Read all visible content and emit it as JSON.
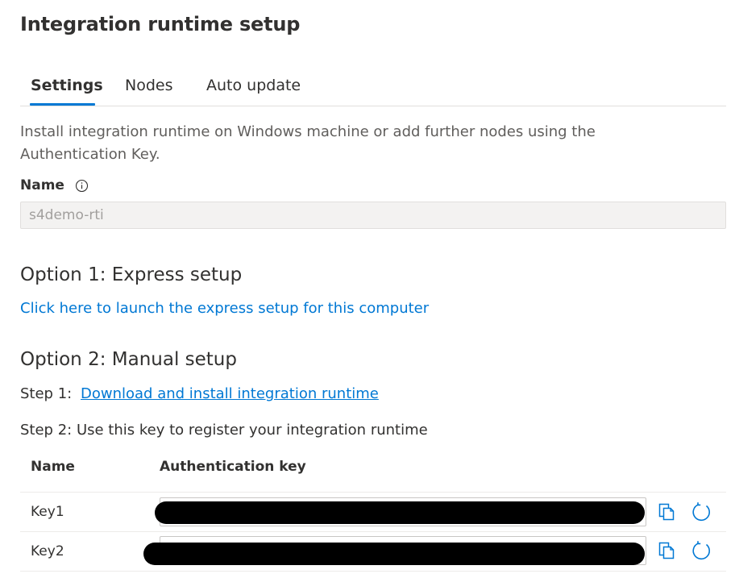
{
  "header": {
    "title": "Integration runtime setup"
  },
  "tabs": [
    {
      "label": "Settings",
      "active": true
    },
    {
      "label": "Nodes",
      "active": false
    },
    {
      "label": "Auto update",
      "active": false
    }
  ],
  "description": "Install integration runtime on Windows machine or add further nodes using the Authentication Key.",
  "name_field": {
    "label": "Name",
    "value": "s4demo-rti",
    "info_icon": "info-icon"
  },
  "option1": {
    "heading": "Option 1: Express setup",
    "link": "Click here to launch the express setup for this computer"
  },
  "option2": {
    "heading": "Option 2: Manual setup",
    "step1_label": "Step 1:",
    "step1_link": "Download and install integration runtime",
    "step2_label": "Step 2: Use this key to register your integration runtime"
  },
  "keys_table": {
    "columns": [
      "Name",
      "Authentication key"
    ],
    "rows": [
      {
        "name": "Key1"
      },
      {
        "name": "Key2"
      }
    ],
    "actions": [
      "copy-icon",
      "refresh-icon"
    ]
  },
  "colors": {
    "accent": "#0078d4",
    "text": "#323130",
    "muted": "#605e5c",
    "disabled_bg": "#f3f2f1"
  }
}
